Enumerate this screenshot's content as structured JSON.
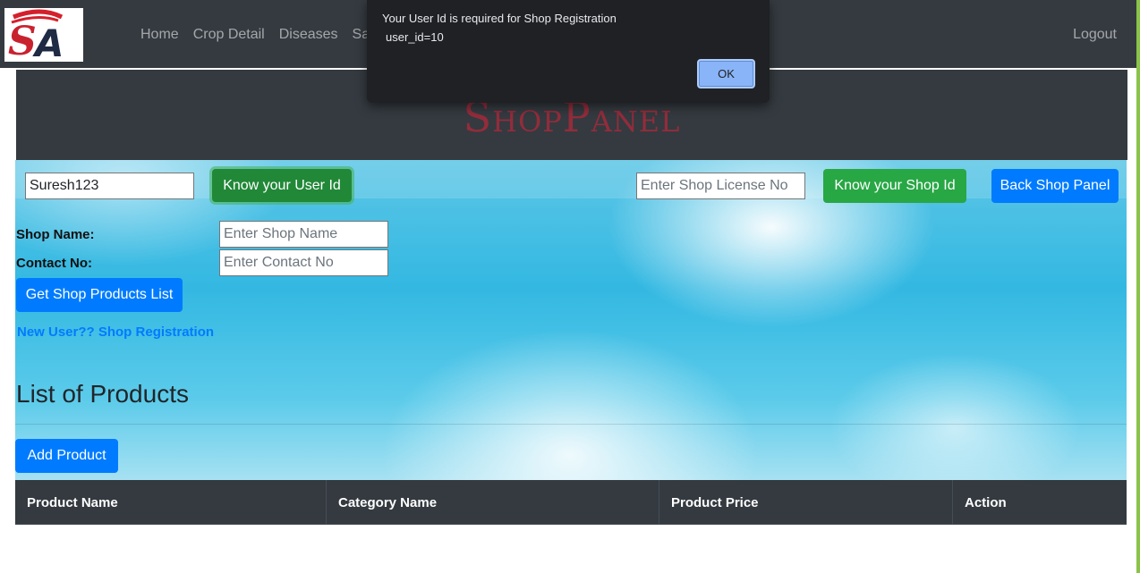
{
  "navbar": {
    "logo_text": "SA",
    "links": [
      "Home",
      "Crop Detail",
      "Diseases",
      "Sale"
    ],
    "logout_label": "Logout"
  },
  "banner": {
    "title": "ShopPanel"
  },
  "toolbar": {
    "username_value": "Suresh123",
    "know_user_id_label": "Know your User Id",
    "license_placeholder": "Enter Shop License No",
    "know_shop_id_label": "Know your Shop Id",
    "back_label": "Back Shop Panel"
  },
  "form": {
    "shop_name_label": "Shop Name:",
    "shop_name_placeholder": "Enter Shop Name",
    "contact_label": "Contact No:",
    "contact_placeholder": "Enter Contact No",
    "get_products_label": "Get Shop Products List",
    "registration_link": "New User?? Shop Registration"
  },
  "products": {
    "heading": "List of Products",
    "add_label": "Add Product",
    "columns": [
      "Product Name",
      "Category Name",
      "Product Price",
      "Action"
    ]
  },
  "dialog": {
    "message": "Your User Id is required for Shop Registration",
    "detail": "user_id=10",
    "ok_label": "OK"
  },
  "colors": {
    "navbar": "#343a40",
    "primary": "#007bff",
    "success": "#28a745",
    "brand_red": "#b3283a",
    "link": "#007bff"
  }
}
